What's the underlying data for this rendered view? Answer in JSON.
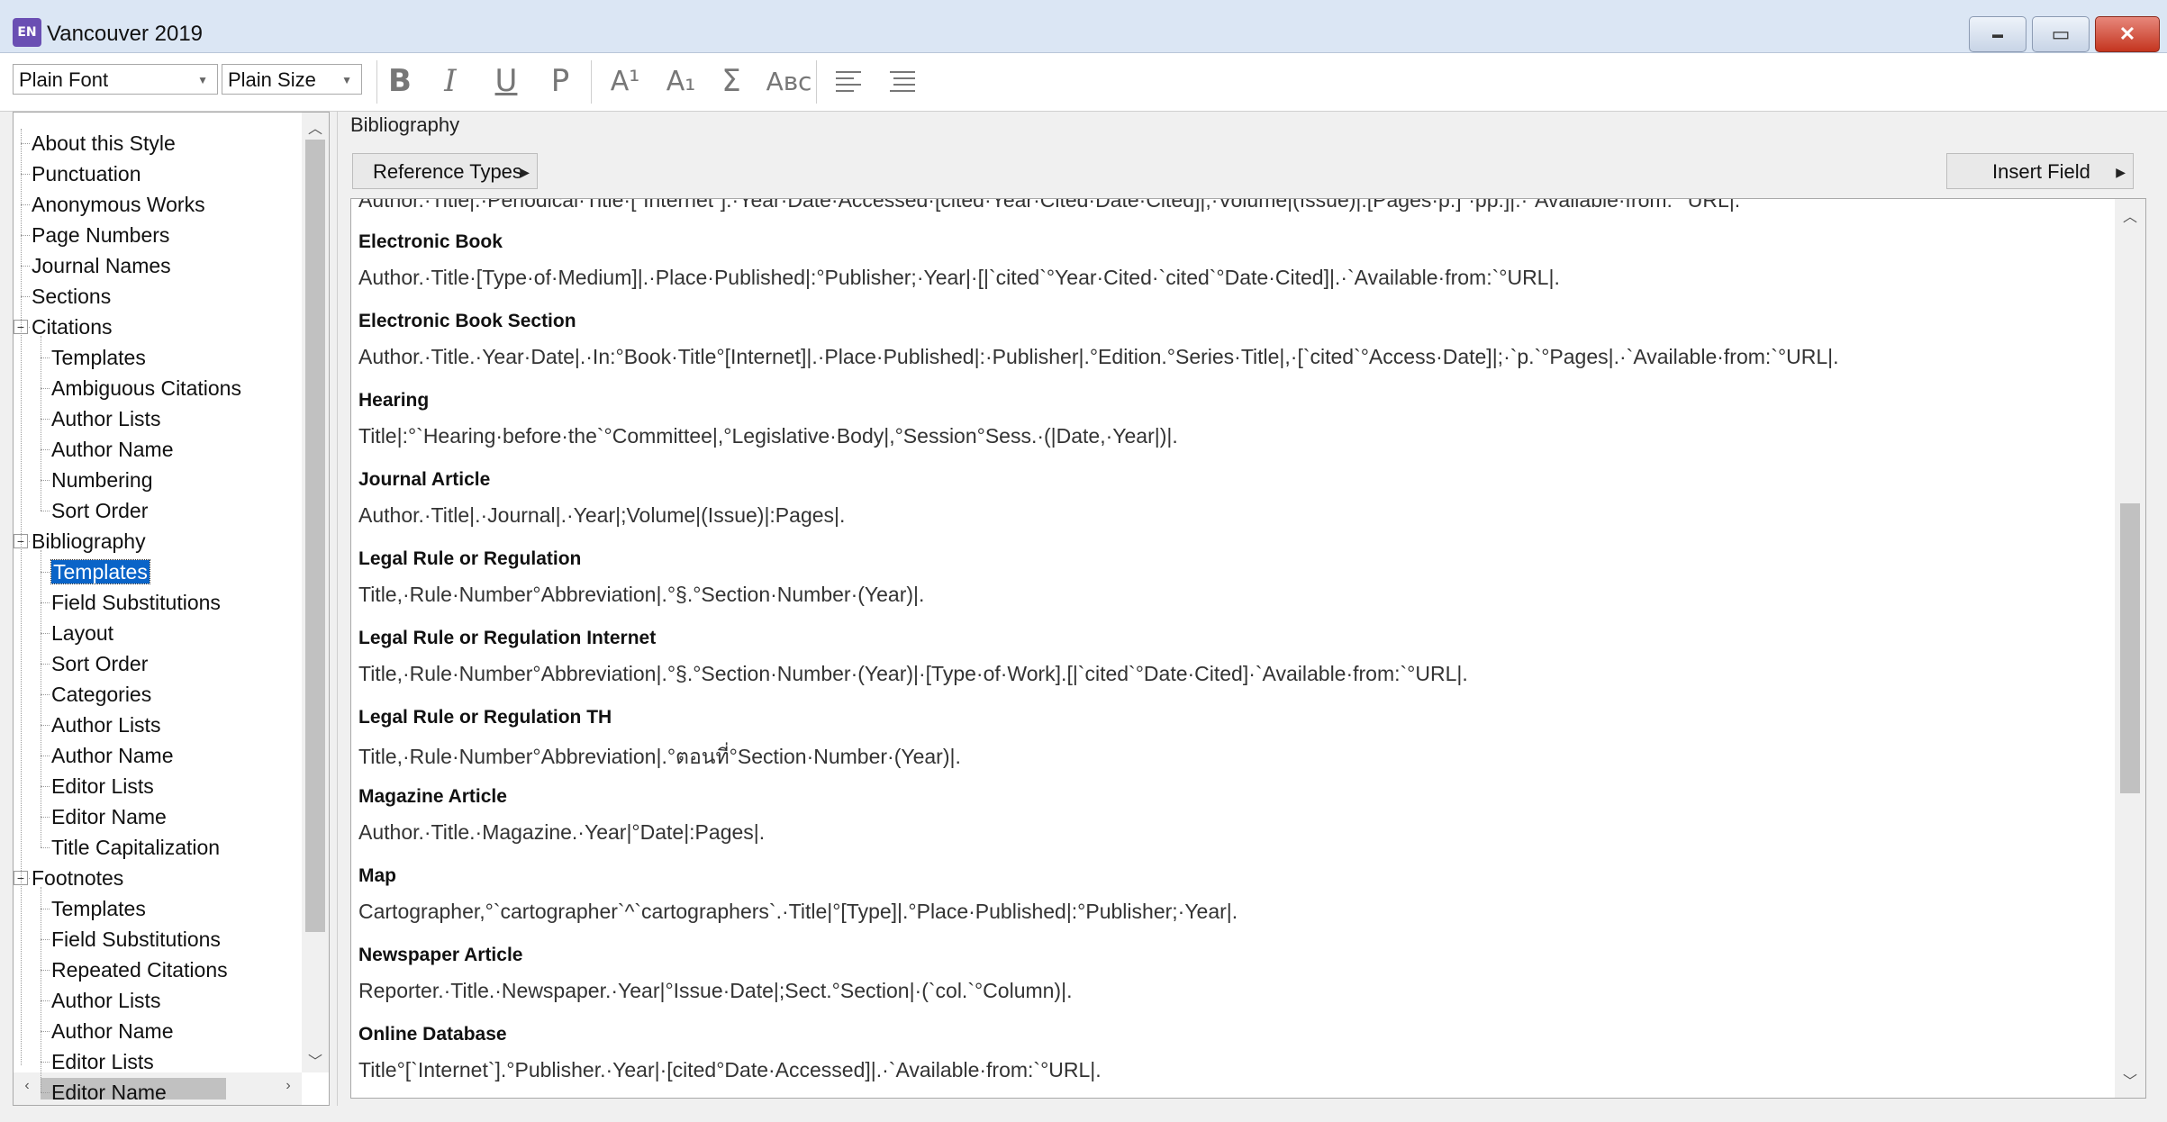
{
  "window": {
    "icon_text": "EN",
    "title": "Vancouver 2019",
    "minimize": "▬",
    "maximize": "▭",
    "close": "✕"
  },
  "toolbar": {
    "font": "Plain Font",
    "size": "Plain Size",
    "bold": "B",
    "italic": "I",
    "underline": "U",
    "plain": "P",
    "superscript": "A¹",
    "subscript": "A₁",
    "symbol": "Σ",
    "smallcaps": "Aʙᴄ"
  },
  "tree": {
    "items": [
      {
        "label": "About this Style",
        "level": 0
      },
      {
        "label": "Punctuation",
        "level": 0
      },
      {
        "label": "Anonymous Works",
        "level": 0
      },
      {
        "label": "Page Numbers",
        "level": 0
      },
      {
        "label": "Journal Names",
        "level": 0
      },
      {
        "label": "Sections",
        "level": 0
      },
      {
        "label": "Citations",
        "level": 0,
        "expander": "−"
      },
      {
        "label": "Templates",
        "level": 1
      },
      {
        "label": "Ambiguous Citations",
        "level": 1
      },
      {
        "label": "Author Lists",
        "level": 1
      },
      {
        "label": "Author Name",
        "level": 1
      },
      {
        "label": "Numbering",
        "level": 1
      },
      {
        "label": "Sort Order",
        "level": 1
      },
      {
        "label": "Bibliography",
        "level": 0,
        "expander": "−"
      },
      {
        "label": "Templates",
        "level": 1,
        "selected": true
      },
      {
        "label": "Field Substitutions",
        "level": 1
      },
      {
        "label": "Layout",
        "level": 1
      },
      {
        "label": "Sort Order",
        "level": 1
      },
      {
        "label": "Categories",
        "level": 1
      },
      {
        "label": "Author Lists",
        "level": 1
      },
      {
        "label": "Author Name",
        "level": 1
      },
      {
        "label": "Editor Lists",
        "level": 1
      },
      {
        "label": "Editor Name",
        "level": 1
      },
      {
        "label": "Title Capitalization",
        "level": 1
      },
      {
        "label": "Footnotes",
        "level": 0,
        "expander": "−"
      },
      {
        "label": "Templates",
        "level": 1
      },
      {
        "label": "Field Substitutions",
        "level": 1
      },
      {
        "label": "Repeated Citations",
        "level": 1
      },
      {
        "label": "Author Lists",
        "level": 1
      },
      {
        "label": "Author Name",
        "level": 1
      },
      {
        "label": "Editor Lists",
        "level": 1
      },
      {
        "label": "Editor Name",
        "level": 1
      }
    ]
  },
  "panel": {
    "section_label": "Bibliography",
    "reference_types": "Reference Types",
    "insert_field": "Insert Field",
    "cut_line": "Author.·Title|.·Periodical·Title·[`Internet`].·Year·Date·Accessed·[cited·Year·Cited·Date·Cited]|;·Volume|(Issue)|:[Pages·p.]`·pp.]|.·`Available·from:`°URL|.",
    "templates": [
      {
        "name": "Electronic Book",
        "text": "Author.·Title·[Type·of·Medium]|.·Place·Published|:°Publisher;·Year|·[|`cited`°Year·Cited·`cited`°Date·Cited]|.·`Available·from:`°URL|."
      },
      {
        "name": "Electronic Book Section",
        "text": "Author.·Title.·Year·Date|.·In:°Book·Title°[Internet]|.·Place·Published|:·Publisher|.°Edition.°Series·Title|,·[`cited`°Access·Date]|;·`p.`°Pages|.·`Available·from:`°URL|."
      },
      {
        "name": "Hearing",
        "text": "Title|:°`Hearing·before·the`°Committee|,°Legislative·Body|,°Session°Sess.·(|Date,·Year|)|."
      },
      {
        "name": "Journal Article",
        "text": "Author.·Title|.·Journal|.·Year|;Volume|(Issue)|:Pages|."
      },
      {
        "name": "Legal Rule or Regulation",
        "text": "Title,·Rule·Number°Abbreviation|.°§.°Section·Number·(Year)|."
      },
      {
        "name": "Legal Rule or Regulation Internet",
        "text": "Title,·Rule·Number°Abbreviation|.°§.°Section·Number·(Year)|·[Type·of·Work].[|`cited`°Date·Cited]·`Available·from:`°URL|."
      },
      {
        "name": "Legal Rule or Regulation TH",
        "text": "Title,·Rule·Number°Abbreviation|.°ตอนที่°Section·Number·(Year)|."
      },
      {
        "name": "Magazine Article",
        "text": "Author.·Title.·Magazine.·Year|°Date|:Pages|."
      },
      {
        "name": "Map",
        "text": "Cartographer,°`cartographer`^`cartographers`.·Title|°[Type]|.°Place·Published|:°Publisher;·Year|."
      },
      {
        "name": "Newspaper Article",
        "text": "Reporter.·Title.·Newspaper.·Year|°Issue·Date|;Sect.°Section|·(`col.`°Column)|."
      },
      {
        "name": "Online Database",
        "text": "Title°[`Internet`].°Publisher.·Year|·[cited°Date·Accessed]|.·`Available·from:`°URL|."
      }
    ]
  }
}
